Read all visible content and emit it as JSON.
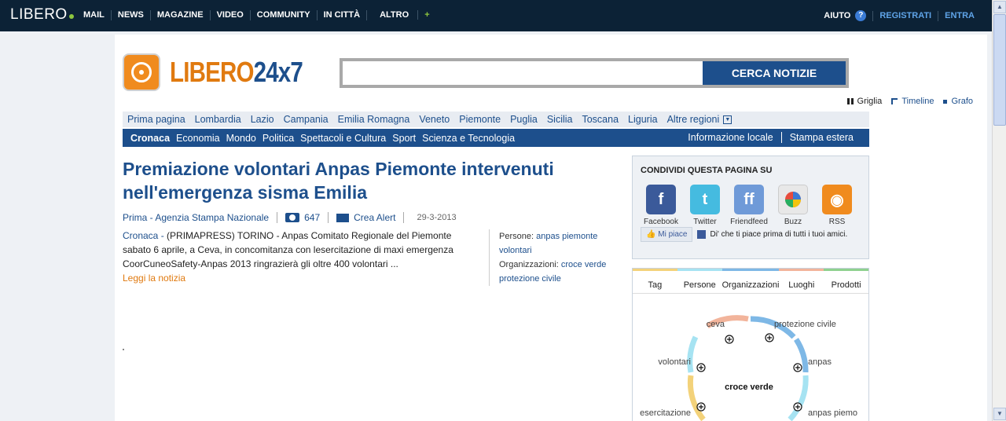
{
  "topbar": {
    "logo": "LIBERO",
    "nav": [
      "MAIL",
      "NEWS",
      "MAGAZINE",
      "VIDEO",
      "COMMUNITY",
      "IN CITTÀ",
      "ALTRO"
    ],
    "altro_plus": "+",
    "aiuto": "AIUTO",
    "help_icon": "?",
    "registrati": "REGISTRATI",
    "entra": "ENTRA"
  },
  "brand": {
    "name_a": "LIBERO",
    "name_b": "24x7"
  },
  "search": {
    "placeholder": "",
    "button": "CERCA NOTIZIE"
  },
  "views": {
    "griglia": "Griglia",
    "timeline": "Timeline",
    "grafo": "Grafo"
  },
  "regions": {
    "items": [
      "Prima pagina",
      "Lombardia",
      "Lazio",
      "Campania",
      "Emilia Romagna",
      "Veneto",
      "Piemonte",
      "Puglia",
      "Sicilia",
      "Toscana",
      "Liguria"
    ],
    "more": "Altre regioni",
    "more_icon": "▼"
  },
  "categories": {
    "items": [
      "Cronaca",
      "Economia",
      "Mondo",
      "Politica",
      "Spettacoli e Cultura",
      "Sport",
      "Scienza e Tecnologia"
    ],
    "right": [
      "Informazione locale",
      "Stampa estera"
    ]
  },
  "article": {
    "title": "Premiazione volontari Anpas Piemonte intervenuti nell'emergenza sisma Emilia",
    "source": "Prima - Agenzia Stampa Nazionale",
    "photos": "647",
    "alert": "Crea Alert",
    "date": "29-3-2013",
    "category": "Cronaca -",
    "text": " (PRIMAPRESS) TORINO - Anpas Comitato Regionale del Piemonte sabato 6 aprile, a Ceva, in concomitanza con lesercitazione di maxi emergenza CoorCuneoSafety-Anpas 2013 ringrazierà gli oltre 400 volontari ...",
    "read_more": "Leggi la notizia",
    "persone_label": "Persone:",
    "persone": "anpas piemonte volontari",
    "org_label": "Organizzazioni:",
    "organizzazioni": "croce verde protezione civile"
  },
  "share": {
    "heading": "CONDIVIDI QUESTA PAGINA SU",
    "items": [
      "Facebook",
      "Twitter",
      "Friendfeed",
      "Buzz",
      "RSS"
    ],
    "like_button": "Mi piace",
    "like_text": "Di' che ti piace prima di tutti i tuoi amici."
  },
  "tags": {
    "tabs": [
      "Tag",
      "Persone",
      "Organizzazioni",
      "Luoghi",
      "Prodotti"
    ],
    "tab_colors": [
      "#f3d27a",
      "#a6e3f2",
      "#7eb8e6",
      "#f2b49b",
      "#8fd18f"
    ],
    "center": "croce verde",
    "nodes": [
      "ceva",
      "protezione civile",
      "volontari",
      "anpas",
      "esercitazione",
      "anpas piemo"
    ]
  }
}
